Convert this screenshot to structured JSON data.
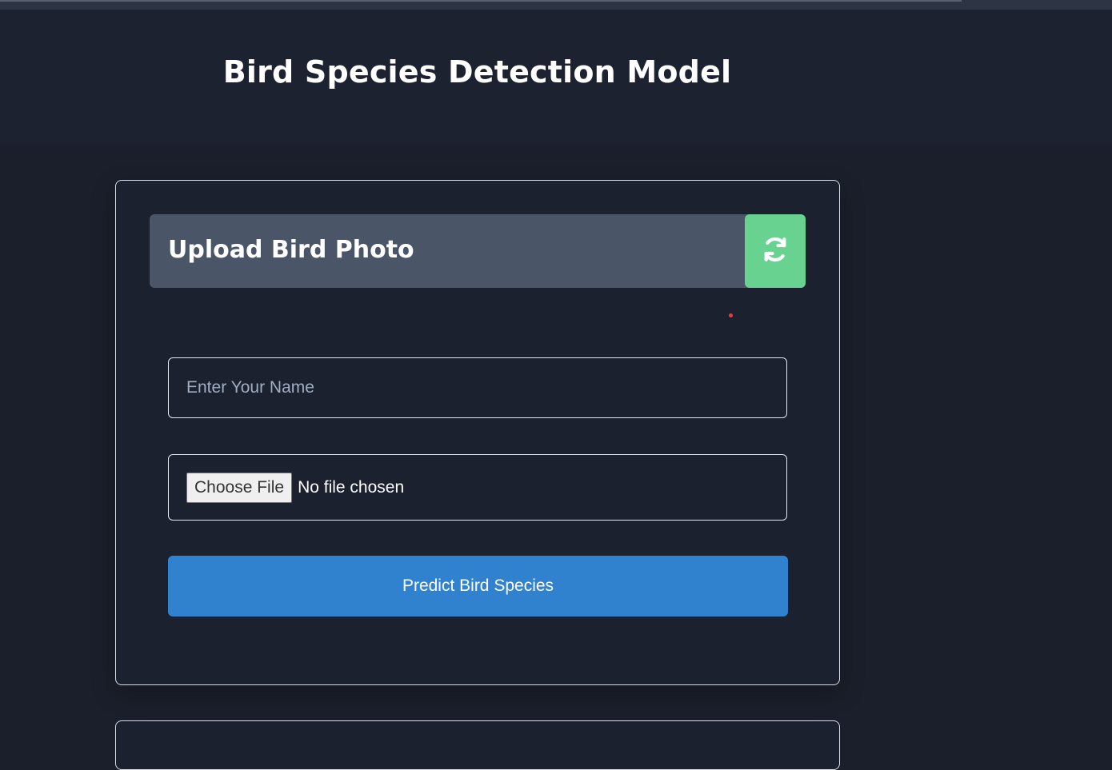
{
  "header": {
    "title": "Bird Species Detection Model"
  },
  "upload_card": {
    "title": "Upload Bird Photo",
    "refresh_icon": "refresh-icon",
    "refresh_color": "#68d391",
    "name_placeholder": "Enter Your Name",
    "name_value": "",
    "file_button_label": "Choose File",
    "file_status": "No file chosen",
    "predict_label": "Predict Bird Species",
    "predict_color": "#3182ce"
  },
  "colors": {
    "background": "#1a1f2b",
    "header_bar": "#4a5568",
    "accent_dot": "#e53e3e"
  }
}
